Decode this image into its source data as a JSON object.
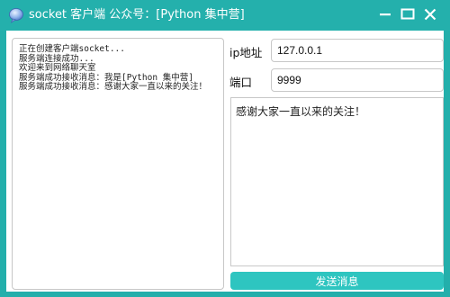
{
  "window": {
    "title": "socket 客户端  公众号：[Python 集中营]",
    "icon": "chat-bubble-icon",
    "controls": [
      "minimize-icon",
      "maximize-icon",
      "close-icon"
    ]
  },
  "log": {
    "lines": [
      "正在创建客户端socket...",
      "服务端连接成功...",
      "欢迎来到网络聊天室",
      "服务端成功接收消息：我是[Python 集中营]",
      "服务端成功接收消息：感谢大家一直以来的关注！"
    ]
  },
  "form": {
    "ip_label": "ip地址",
    "ip_value": "127.0.0.1",
    "port_label": "端口",
    "port_value": "9999",
    "message_value": "感谢大家一直以来的关注！",
    "send_label": "发送消息"
  },
  "colors": {
    "titlebar": "#24b0ac",
    "button": "#2ec5c0"
  }
}
